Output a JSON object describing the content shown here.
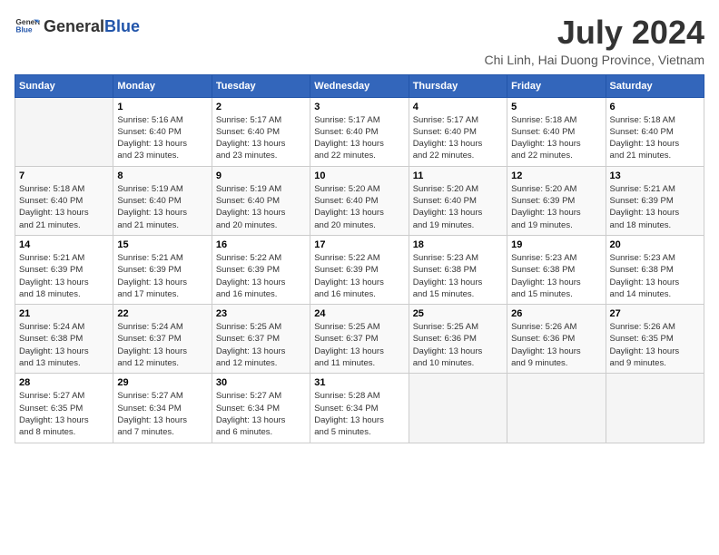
{
  "header": {
    "logo_general": "General",
    "logo_blue": "Blue",
    "month_title": "July 2024",
    "location": "Chi Linh, Hai Duong Province, Vietnam"
  },
  "weekdays": [
    "Sunday",
    "Monday",
    "Tuesday",
    "Wednesday",
    "Thursday",
    "Friday",
    "Saturday"
  ],
  "weeks": [
    [
      {
        "day": "",
        "detail": ""
      },
      {
        "day": "1",
        "detail": "Sunrise: 5:16 AM\nSunset: 6:40 PM\nDaylight: 13 hours\nand 23 minutes."
      },
      {
        "day": "2",
        "detail": "Sunrise: 5:17 AM\nSunset: 6:40 PM\nDaylight: 13 hours\nand 23 minutes."
      },
      {
        "day": "3",
        "detail": "Sunrise: 5:17 AM\nSunset: 6:40 PM\nDaylight: 13 hours\nand 22 minutes."
      },
      {
        "day": "4",
        "detail": "Sunrise: 5:17 AM\nSunset: 6:40 PM\nDaylight: 13 hours\nand 22 minutes."
      },
      {
        "day": "5",
        "detail": "Sunrise: 5:18 AM\nSunset: 6:40 PM\nDaylight: 13 hours\nand 22 minutes."
      },
      {
        "day": "6",
        "detail": "Sunrise: 5:18 AM\nSunset: 6:40 PM\nDaylight: 13 hours\nand 21 minutes."
      }
    ],
    [
      {
        "day": "7",
        "detail": "Sunrise: 5:18 AM\nSunset: 6:40 PM\nDaylight: 13 hours\nand 21 minutes."
      },
      {
        "day": "8",
        "detail": "Sunrise: 5:19 AM\nSunset: 6:40 PM\nDaylight: 13 hours\nand 21 minutes."
      },
      {
        "day": "9",
        "detail": "Sunrise: 5:19 AM\nSunset: 6:40 PM\nDaylight: 13 hours\nand 20 minutes."
      },
      {
        "day": "10",
        "detail": "Sunrise: 5:20 AM\nSunset: 6:40 PM\nDaylight: 13 hours\nand 20 minutes."
      },
      {
        "day": "11",
        "detail": "Sunrise: 5:20 AM\nSunset: 6:40 PM\nDaylight: 13 hours\nand 19 minutes."
      },
      {
        "day": "12",
        "detail": "Sunrise: 5:20 AM\nSunset: 6:39 PM\nDaylight: 13 hours\nand 19 minutes."
      },
      {
        "day": "13",
        "detail": "Sunrise: 5:21 AM\nSunset: 6:39 PM\nDaylight: 13 hours\nand 18 minutes."
      }
    ],
    [
      {
        "day": "14",
        "detail": "Sunrise: 5:21 AM\nSunset: 6:39 PM\nDaylight: 13 hours\nand 18 minutes."
      },
      {
        "day": "15",
        "detail": "Sunrise: 5:21 AM\nSunset: 6:39 PM\nDaylight: 13 hours\nand 17 minutes."
      },
      {
        "day": "16",
        "detail": "Sunrise: 5:22 AM\nSunset: 6:39 PM\nDaylight: 13 hours\nand 16 minutes."
      },
      {
        "day": "17",
        "detail": "Sunrise: 5:22 AM\nSunset: 6:39 PM\nDaylight: 13 hours\nand 16 minutes."
      },
      {
        "day": "18",
        "detail": "Sunrise: 5:23 AM\nSunset: 6:38 PM\nDaylight: 13 hours\nand 15 minutes."
      },
      {
        "day": "19",
        "detail": "Sunrise: 5:23 AM\nSunset: 6:38 PM\nDaylight: 13 hours\nand 15 minutes."
      },
      {
        "day": "20",
        "detail": "Sunrise: 5:23 AM\nSunset: 6:38 PM\nDaylight: 13 hours\nand 14 minutes."
      }
    ],
    [
      {
        "day": "21",
        "detail": "Sunrise: 5:24 AM\nSunset: 6:38 PM\nDaylight: 13 hours\nand 13 minutes."
      },
      {
        "day": "22",
        "detail": "Sunrise: 5:24 AM\nSunset: 6:37 PM\nDaylight: 13 hours\nand 12 minutes."
      },
      {
        "day": "23",
        "detail": "Sunrise: 5:25 AM\nSunset: 6:37 PM\nDaylight: 13 hours\nand 12 minutes."
      },
      {
        "day": "24",
        "detail": "Sunrise: 5:25 AM\nSunset: 6:37 PM\nDaylight: 13 hours\nand 11 minutes."
      },
      {
        "day": "25",
        "detail": "Sunrise: 5:25 AM\nSunset: 6:36 PM\nDaylight: 13 hours\nand 10 minutes."
      },
      {
        "day": "26",
        "detail": "Sunrise: 5:26 AM\nSunset: 6:36 PM\nDaylight: 13 hours\nand 9 minutes."
      },
      {
        "day": "27",
        "detail": "Sunrise: 5:26 AM\nSunset: 6:35 PM\nDaylight: 13 hours\nand 9 minutes."
      }
    ],
    [
      {
        "day": "28",
        "detail": "Sunrise: 5:27 AM\nSunset: 6:35 PM\nDaylight: 13 hours\nand 8 minutes."
      },
      {
        "day": "29",
        "detail": "Sunrise: 5:27 AM\nSunset: 6:34 PM\nDaylight: 13 hours\nand 7 minutes."
      },
      {
        "day": "30",
        "detail": "Sunrise: 5:27 AM\nSunset: 6:34 PM\nDaylight: 13 hours\nand 6 minutes."
      },
      {
        "day": "31",
        "detail": "Sunrise: 5:28 AM\nSunset: 6:34 PM\nDaylight: 13 hours\nand 5 minutes."
      },
      {
        "day": "",
        "detail": ""
      },
      {
        "day": "",
        "detail": ""
      },
      {
        "day": "",
        "detail": ""
      }
    ]
  ]
}
